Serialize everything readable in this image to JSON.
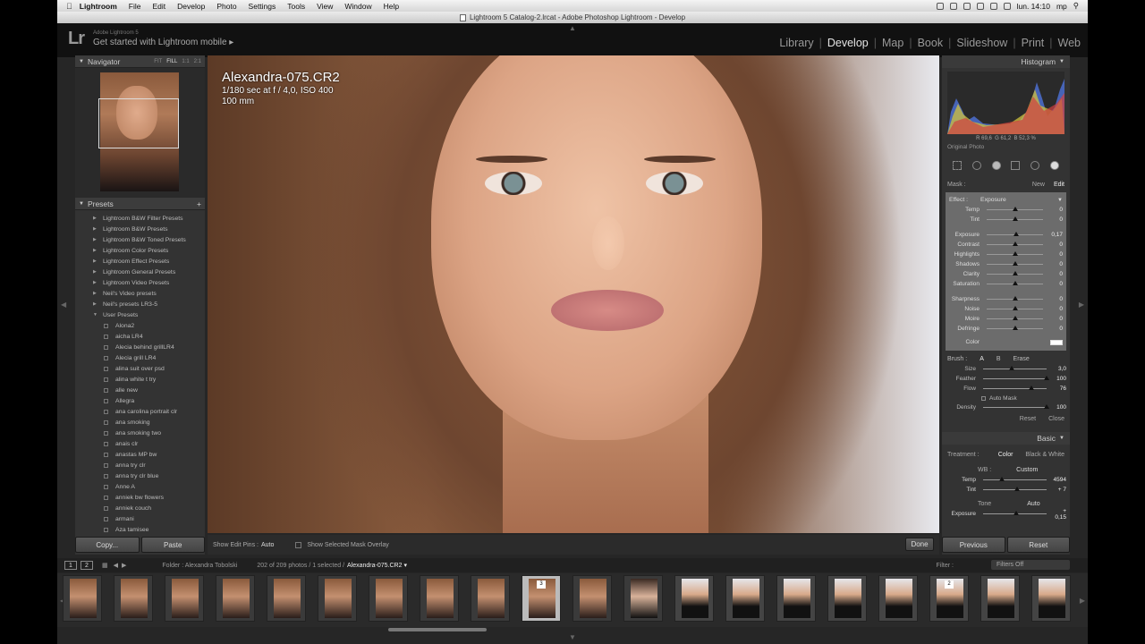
{
  "menubar": {
    "app": "Lightroom",
    "items": [
      "File",
      "Edit",
      "Develop",
      "Photo",
      "Settings",
      "Tools",
      "View",
      "Window",
      "Help"
    ],
    "datetime": "lun. 14:10",
    "user": "mp"
  },
  "window": {
    "title": "Lightroom 5 Catalog-2.lrcat - Adobe Photoshop Lightroom - Develop"
  },
  "identity": {
    "logo": "Lr",
    "version": "Adobe Lightroom 5",
    "tagline": "Get started with Lightroom mobile ▸"
  },
  "modules": {
    "items": [
      "Library",
      "Develop",
      "Map",
      "Book",
      "Slideshow",
      "Print",
      "Web"
    ],
    "active": "Develop"
  },
  "navigator": {
    "title": "Navigator",
    "options": [
      "FIT",
      "FILL",
      "1:1",
      "2:1"
    ],
    "active": "FILL"
  },
  "presets": {
    "title": "Presets",
    "add": "+",
    "folders": [
      "Lightroom B&W Filter Presets",
      "Lightroom B&W Presets",
      "Lightroom B&W Toned Presets",
      "Lightroom Color Presets",
      "Lightroom Effect Presets",
      "Lightroom General Presets",
      "Lightroom Video Presets",
      "Neil's Video presets",
      "Neil's presets LR3-5",
      "User Presets"
    ],
    "user_items": [
      "Alona2",
      "aicha LR4",
      "Alecia behind grillLR4",
      "Alecia grill LR4",
      "alina suit over psd",
      "alina white t try",
      "alle new",
      "Allegra",
      "ana carolina portrait clr",
      "ana smoking",
      "ana smoking two",
      "anais clr",
      "anastas MP bw",
      "anna try clr",
      "anna try clr blue",
      "Anne A",
      "anniek bw flowers",
      "anniek couch",
      "armani",
      "Aza tamisee"
    ]
  },
  "left_buttons": {
    "copy": "Copy...",
    "paste": "Paste"
  },
  "photo": {
    "filename": "Alexandra-075.CR2",
    "exposure": "1/180 sec at f / 4,0, ISO 400",
    "focal": "100 mm"
  },
  "toolbar": {
    "pins_label": "Show Edit Pins :",
    "pins_value": "Auto",
    "overlay_label": "Show Selected Mask Overlay",
    "done": "Done"
  },
  "histogram": {
    "title": "Histogram",
    "r": "R 69,6",
    "g": "G 61,2",
    "b": "B 52,3 %",
    "original": "Original Photo"
  },
  "mask": {
    "label": "Mask :",
    "new": "New",
    "edit": "Edit"
  },
  "effect": {
    "label": "Effect :",
    "value": "Exposure",
    "sliders": [
      {
        "label": "Temp",
        "value": "0",
        "pos": 0.5
      },
      {
        "label": "Tint",
        "value": "0",
        "pos": 0.5
      },
      {
        "label": "Exposure",
        "value": "0,17",
        "pos": 0.53
      },
      {
        "label": "Contrast",
        "value": "0",
        "pos": 0.5
      },
      {
        "label": "Highlights",
        "value": "0",
        "pos": 0.5
      },
      {
        "label": "Shadows",
        "value": "0",
        "pos": 0.5
      },
      {
        "label": "Clarity",
        "value": "0",
        "pos": 0.5
      },
      {
        "label": "Saturation",
        "value": "0",
        "pos": 0.5
      },
      {
        "label": "Sharpness",
        "value": "0",
        "pos": 0.5
      },
      {
        "label": "Noise",
        "value": "0",
        "pos": 0.5
      },
      {
        "label": "Moire",
        "value": "0",
        "pos": 0.5
      },
      {
        "label": "Defringe",
        "value": "0",
        "pos": 0.5
      }
    ],
    "color_label": "Color"
  },
  "brush": {
    "label": "Brush :",
    "options": [
      "A",
      "B",
      "Erase"
    ],
    "active": "A",
    "sliders": [
      {
        "label": "Size",
        "value": "3,0",
        "pos": 0.45
      },
      {
        "label": "Feather",
        "value": "100",
        "pos": 1.0
      },
      {
        "label": "Flow",
        "value": "76",
        "pos": 0.76
      }
    ],
    "automask": "Auto Mask",
    "density": {
      "label": "Density",
      "value": "100",
      "pos": 1.0
    },
    "reset": "Reset",
    "close": "Close"
  },
  "basic": {
    "title": "Basic",
    "treatment_label": "Treatment :",
    "color": "Color",
    "bw": "Black & White",
    "wb_label": "WB :",
    "wb_value": "Custom",
    "temp": {
      "label": "Temp",
      "value": "4594",
      "pos": 0.3
    },
    "tint": {
      "label": "Tint",
      "value": "+ 7",
      "pos": 0.53
    },
    "tone_label": "Tone",
    "tone_auto": "Auto",
    "exposure": {
      "label": "Exposure",
      "value": "+ 0,15",
      "pos": 0.52
    }
  },
  "right_buttons": {
    "previous": "Previous",
    "reset": "Reset"
  },
  "filmstrip": {
    "screens": [
      "1",
      "2"
    ],
    "folder": "Folder : Alexandra Tobolski",
    "count": "202 of 209 photos / 1 selected /",
    "current": "Alexandra-075.CR2 ▾",
    "filter_label": "Filter :",
    "filters_off": "Filters Off",
    "thumb_count": 20,
    "selected_index": 9,
    "badges": [
      {
        "index": 9,
        "label": "3"
      },
      {
        "index": 17,
        "label": "2"
      }
    ]
  }
}
